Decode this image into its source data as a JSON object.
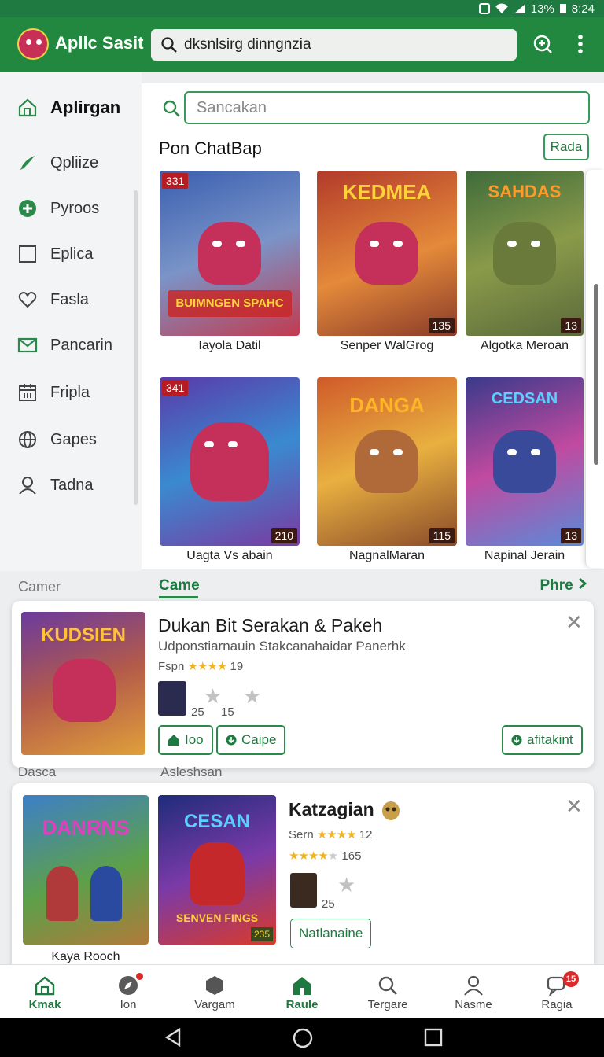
{
  "status": {
    "battery": "13%",
    "time": "8:24"
  },
  "header": {
    "title": "Apllc Sasit",
    "search_value": "dksnlsirg dinngnzia"
  },
  "sidebar": {
    "items": [
      {
        "label": "Aplirgan",
        "icon": "home-icon",
        "active": true
      },
      {
        "label": "Qpliize",
        "icon": "pen-icon"
      },
      {
        "label": "Pyroos",
        "icon": "plus-circle-icon"
      },
      {
        "label": "Eplica",
        "icon": "square-icon"
      },
      {
        "label": "Fasla",
        "icon": "heart-icon"
      },
      {
        "label": "Pancarin",
        "icon": "mail-icon"
      },
      {
        "label": "Fripla",
        "icon": "calendar-icon"
      },
      {
        "label": "Gapes",
        "icon": "globe-icon"
      },
      {
        "label": "Tadna",
        "icon": "user-icon"
      }
    ]
  },
  "main": {
    "search_placeholder": "Sancakan",
    "section_title": "Pon ChatBap",
    "section_button": "Rada",
    "tiles": [
      {
        "caption": "Iayola Datil",
        "badge": "331",
        "badge_pos": "tl",
        "art_title": "BUIMNGEN SPAHC",
        "colors": [
          "#3a5fb0",
          "#7a94c8",
          "#c23a4f"
        ]
      },
      {
        "caption": "Senper WalGrog",
        "badge": "135",
        "badge_pos": "br",
        "art_title": "KEDMEA",
        "colors": [
          "#b23a2a",
          "#e48a3a",
          "#c4305a"
        ]
      },
      {
        "caption": "Algotka Meroan",
        "badge": "13",
        "badge_pos": "br",
        "art_title": "SAHDAS",
        "colors": [
          "#3e6b3a",
          "#8a9a4a",
          "#5a6a3a"
        ]
      },
      {
        "caption": "Uagta Vs abain",
        "badge": "341",
        "badge_pos": "tl",
        "badge2": "210",
        "art_title": "",
        "colors": [
          "#5a3aa8",
          "#3a8ad0",
          "#c4305a"
        ]
      },
      {
        "caption": "NagnalMaran",
        "badge": "115",
        "badge_pos": "br",
        "art_title": "DANGA",
        "colors": [
          "#d05a2a",
          "#e8b040",
          "#8a4a2a"
        ]
      },
      {
        "caption": "Napinal Jerain",
        "badge": "13",
        "badge_pos": "br",
        "art_title": "CEDSAN",
        "colors": [
          "#3a3a8a",
          "#c04aa0",
          "#5a8ad8"
        ]
      }
    ]
  },
  "category": {
    "left": "Camer",
    "center": "Came",
    "right": "Phre"
  },
  "feature": {
    "title": "Dukan Bit Serakan & Pakeh",
    "subtitle": "Udponstiarnauin Stakcanahaidar Panerhk",
    "rating_label": "Fspn",
    "rating_count": "19",
    "count_a": "25",
    "count_b": "15",
    "btn_a": "Ioo",
    "btn_b": "Caipe",
    "btn_c": "afitakint",
    "cover_title": "KUDSIEN"
  },
  "labels": {
    "left": "Dasca",
    "right": "Asleshsan"
  },
  "second": {
    "caption": "Kaya Rooch",
    "title": "Katzagian",
    "rating1_label": "Sern",
    "rating1_count": "12",
    "rating2_count": "165",
    "count": "25",
    "button": "Natlanaine",
    "cover1_title": "DANRNS",
    "cover2_title": "CESAN",
    "cover2_sub": "SENVEN FINGS",
    "cover2_badge": "235"
  },
  "bottom_nav": [
    {
      "label": "Kmak",
      "icon": "home-icon",
      "active": true
    },
    {
      "label": "Ion",
      "icon": "compass-icon",
      "dot": true
    },
    {
      "label": "Vargam",
      "icon": "hexagon-icon"
    },
    {
      "label": "Raule",
      "icon": "store-icon",
      "active": true
    },
    {
      "label": "Tergare",
      "icon": "search-icon"
    },
    {
      "label": "Nasme",
      "icon": "person-icon"
    },
    {
      "label": "Ragia",
      "icon": "chat-icon",
      "badge": "15"
    }
  ],
  "colors": {
    "primary": "#23883f",
    "primary_dark": "#1e7a40",
    "accent_red": "#d92b2b",
    "star": "#f0b323"
  }
}
